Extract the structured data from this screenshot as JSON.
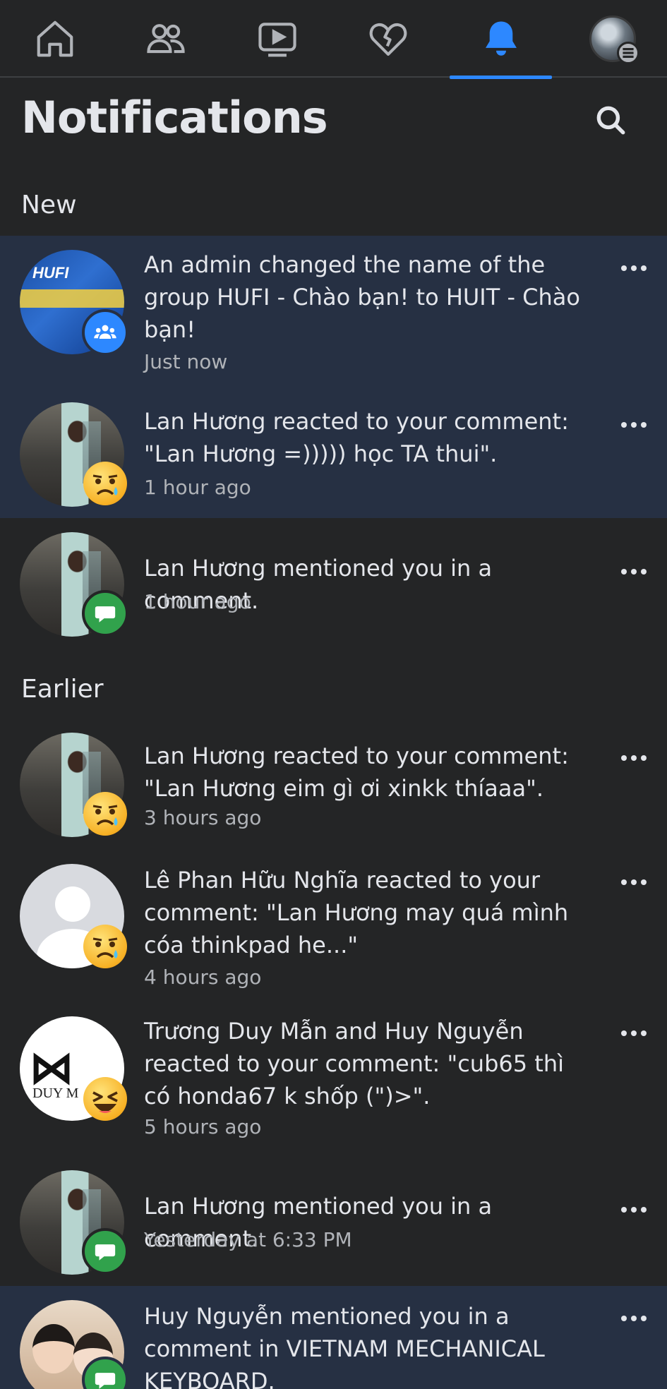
{
  "nav": {
    "tabs": [
      {
        "name": "home",
        "icon": "home-icon"
      },
      {
        "name": "friends",
        "icon": "friends-icon"
      },
      {
        "name": "watch",
        "icon": "video-icon"
      },
      {
        "name": "dating",
        "icon": "heart-icon"
      },
      {
        "name": "notifications",
        "icon": "bell-icon",
        "active": true
      },
      {
        "name": "profile",
        "icon": "avatar"
      }
    ],
    "accent": "#2d88ff"
  },
  "header": {
    "title": "Notifications"
  },
  "sections": {
    "new_label": "New",
    "earlier_label": "Earlier"
  },
  "notifications": [
    {
      "text": "An admin changed the name of the group HUFI - Chào bạn! to HUIT - Chào bạn!",
      "time": "Just now",
      "unread": true,
      "badge": "group-icon",
      "avatar_text": "HUFI"
    },
    {
      "text": "Lan Hương reacted to your comment: \"Lan Hương =))))) học TA thui\".",
      "time": "1 hour ago",
      "unread": true,
      "badge": "sad-reaction-icon"
    },
    {
      "text": "Lan Hương mentioned you in a comment.",
      "time": "1 hour ago",
      "unread": false,
      "badge": "comment-icon"
    },
    {
      "text": "Lan Hương reacted to your comment: \"Lan Hương eim gì ơi xinkk thíaaa\".",
      "time": "3 hours ago",
      "unread": false,
      "badge": "sad-reaction-icon"
    },
    {
      "text": "Lê Phan Hữu Nghĩa reacted to your comment: \"Lan Hương may quá mình cóa thinkpad he...\"",
      "time": "4 hours ago",
      "unread": false,
      "badge": "sad-reaction-icon"
    },
    {
      "text": "Trương Duy Mẫn and Huy Nguyễn reacted to your comment: \"cub65 thì có honda67 k shốp (\")>\".",
      "time": "5 hours ago",
      "unread": false,
      "badge": "haha-reaction-icon",
      "avatar_text": "DUY M"
    },
    {
      "text": "Lan Hương mentioned you in a comment.",
      "time": "Yesterday at 6:33 PM",
      "unread": false,
      "badge": "comment-icon"
    },
    {
      "text": "Huy Nguyễn mentioned you in a comment in VIETNAM MECHANICAL KEYBOARD.",
      "time": "",
      "unread": true,
      "badge": "comment-icon"
    }
  ]
}
